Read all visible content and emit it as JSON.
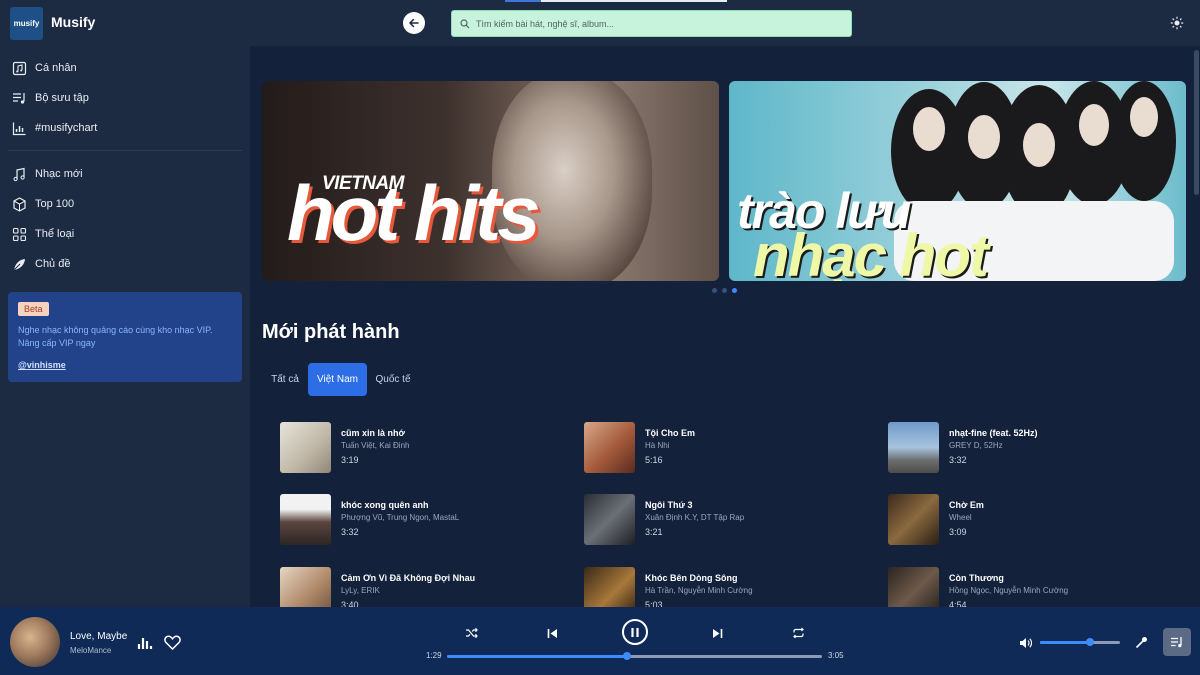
{
  "app": {
    "logo_text": "musify",
    "title": "Musify"
  },
  "search": {
    "placeholder": "Tìm kiếm bài hát, nghệ sĩ, album..."
  },
  "sidebar": {
    "items": [
      {
        "label": "Cá nhân",
        "icon": "personal-music-icon"
      },
      {
        "label": "Bộ sưu tập",
        "icon": "playlist-icon"
      },
      {
        "label": "#musifychart",
        "icon": "chart-icon"
      },
      {
        "label": "Nhạc mới",
        "icon": "new-music-icon"
      },
      {
        "label": "Top 100",
        "icon": "top100-icon"
      },
      {
        "label": "Thể loại",
        "icon": "category-icon"
      },
      {
        "label": "Chủ đề",
        "icon": "topic-icon"
      }
    ],
    "beta": {
      "badge": "Beta",
      "text": "Nghe nhạc không quảng cáo cùng kho nhạc VIP. Nâng cấp VIP ngay",
      "link": "@vinhisme"
    }
  },
  "banners": [
    {
      "small": "VIETNAM",
      "big": "hot hits"
    },
    {
      "line1": "trào lưu",
      "line2": "nhạc hot"
    }
  ],
  "section": {
    "title": "Mới phát hành"
  },
  "tabs": [
    {
      "label": "Tất cả",
      "active": false
    },
    {
      "label": "Việt Nam",
      "active": true
    },
    {
      "label": "Quốc tế",
      "active": false
    }
  ],
  "songs": [
    {
      "title": "cũm xin là nhớ",
      "artist": "Tuấn Việt, Kai Đinh",
      "duration": "3:19"
    },
    {
      "title": "Tội Cho Em",
      "artist": "Hà Nhi",
      "duration": "5:16"
    },
    {
      "title": "nhạt-fine (feat. 52Hz)",
      "artist": "GREY D, 52Hz",
      "duration": "3:32"
    },
    {
      "title": "khóc xong quên anh",
      "artist": "Phượng Vũ, Trung Ngon, MastaL",
      "duration": "3:32"
    },
    {
      "title": "Ngôi Thứ 3",
      "artist": "Xuân Định K.Y, DT Tập Rap",
      "duration": "3:21"
    },
    {
      "title": "Chờ Em",
      "artist": "Wheel",
      "duration": "3:09"
    },
    {
      "title": "Cảm Ơn Vì Đã Không Đợi Nhau",
      "artist": "LyLy, ERIK",
      "duration": "3:40"
    },
    {
      "title": "Khóc Bên Dòng Sông",
      "artist": "Hà Trần, Nguyễn Minh Cường",
      "duration": "5:03"
    },
    {
      "title": "Còn Thương",
      "artist": "Hồng Ngọc, Nguyễn Minh Cường",
      "duration": "4:54"
    }
  ],
  "player": {
    "title": "Love, Maybe",
    "artist": "MeloMance",
    "current_time": "1:29",
    "total_time": "3:05",
    "progress": 0.48,
    "volume": 0.62
  },
  "colors": {
    "accent": "#3c8bff",
    "active_tab": "#2d6ee6",
    "sidebar": "#1d2b42",
    "main": "#14213a",
    "player": "#0f2a57"
  }
}
